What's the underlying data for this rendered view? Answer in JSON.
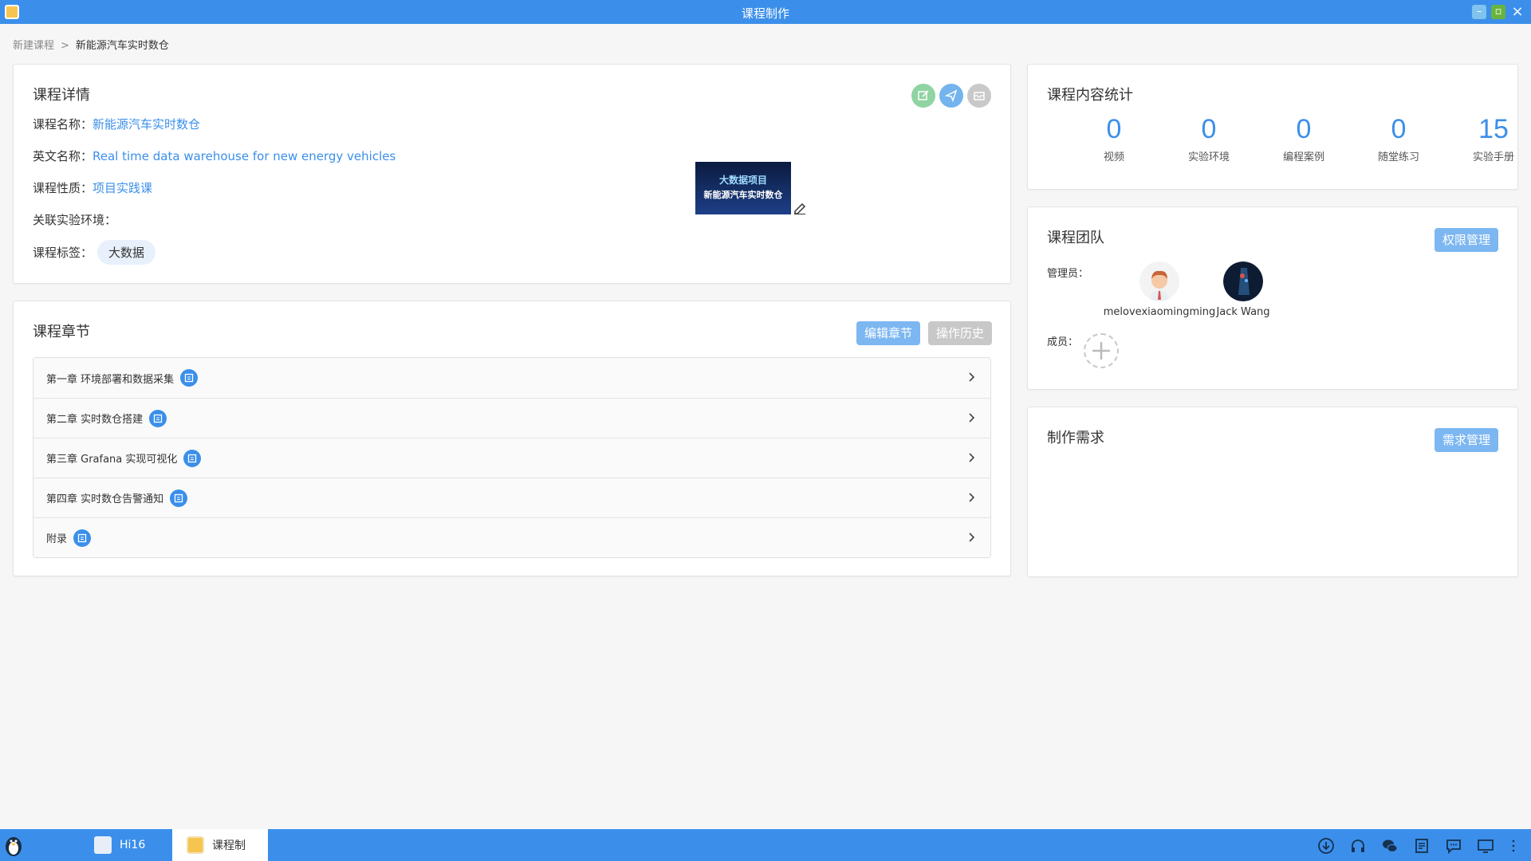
{
  "window": {
    "title": "课程制作"
  },
  "breadcrumb": {
    "root": "新建课程",
    "separator": ">",
    "current": "新能源汽车实时数仓"
  },
  "detail": {
    "title": "课程详情",
    "name_label": "课程名称：",
    "name_value": "新能源汽车实时数仓",
    "en_label": "英文名称：",
    "en_value": "Real time data warehouse for new energy vehicles",
    "type_label": "课程性质：",
    "type_value": "项目实践课",
    "env_label": "关联实验环境：",
    "tag_label": "课程标签：",
    "tag_value": "大数据",
    "cover": {
      "line1": "大数据项目",
      "line2": "新能源汽车实时数仓"
    },
    "action_icons": [
      "edit-icon",
      "send-icon",
      "archive-icon"
    ],
    "action_colors": {
      "edit": "#8fd4a2",
      "send": "#73b4ee",
      "archive": "#c9c9c9"
    }
  },
  "chapters": {
    "title": "课程章节",
    "edit_button": "编辑章节",
    "history_button": "操作历史",
    "items": [
      {
        "label": "第一章 环境部署和数据采集"
      },
      {
        "label": "第二章 实时数仓搭建"
      },
      {
        "label": "第三章 Grafana 实现可视化"
      },
      {
        "label": "第四章 实时数仓告警通知"
      },
      {
        "label": "附录"
      }
    ]
  },
  "stats": {
    "title": "课程内容统计",
    "items": [
      {
        "value": "0",
        "label": "视频"
      },
      {
        "value": "0",
        "label": "实验环境"
      },
      {
        "value": "0",
        "label": "编程案例"
      },
      {
        "value": "0",
        "label": "随堂练习"
      },
      {
        "value": "15",
        "label": "实验手册"
      }
    ]
  },
  "team": {
    "title": "课程团队",
    "manage_button": "权限管理",
    "admin_label": "管理员：",
    "member_label": "成员：",
    "admins": [
      {
        "name": "melovexiaomingming"
      },
      {
        "name": "Jack Wang"
      }
    ]
  },
  "requirements": {
    "title": "制作需求",
    "manage_button": "需求管理"
  },
  "taskbar": {
    "tasks": [
      {
        "label": "Hi16"
      },
      {
        "label": "课程制"
      }
    ],
    "tray_icons": [
      "download-icon",
      "headphones-icon",
      "wechat-icon",
      "document-icon",
      "chat-icon",
      "monitor-icon",
      "more-icon"
    ]
  },
  "colors": {
    "accent": "#3b8fea",
    "title_bar": "#3b8fea",
    "button_light": "#7db7f1",
    "button_gray": "#c8c8c8"
  }
}
